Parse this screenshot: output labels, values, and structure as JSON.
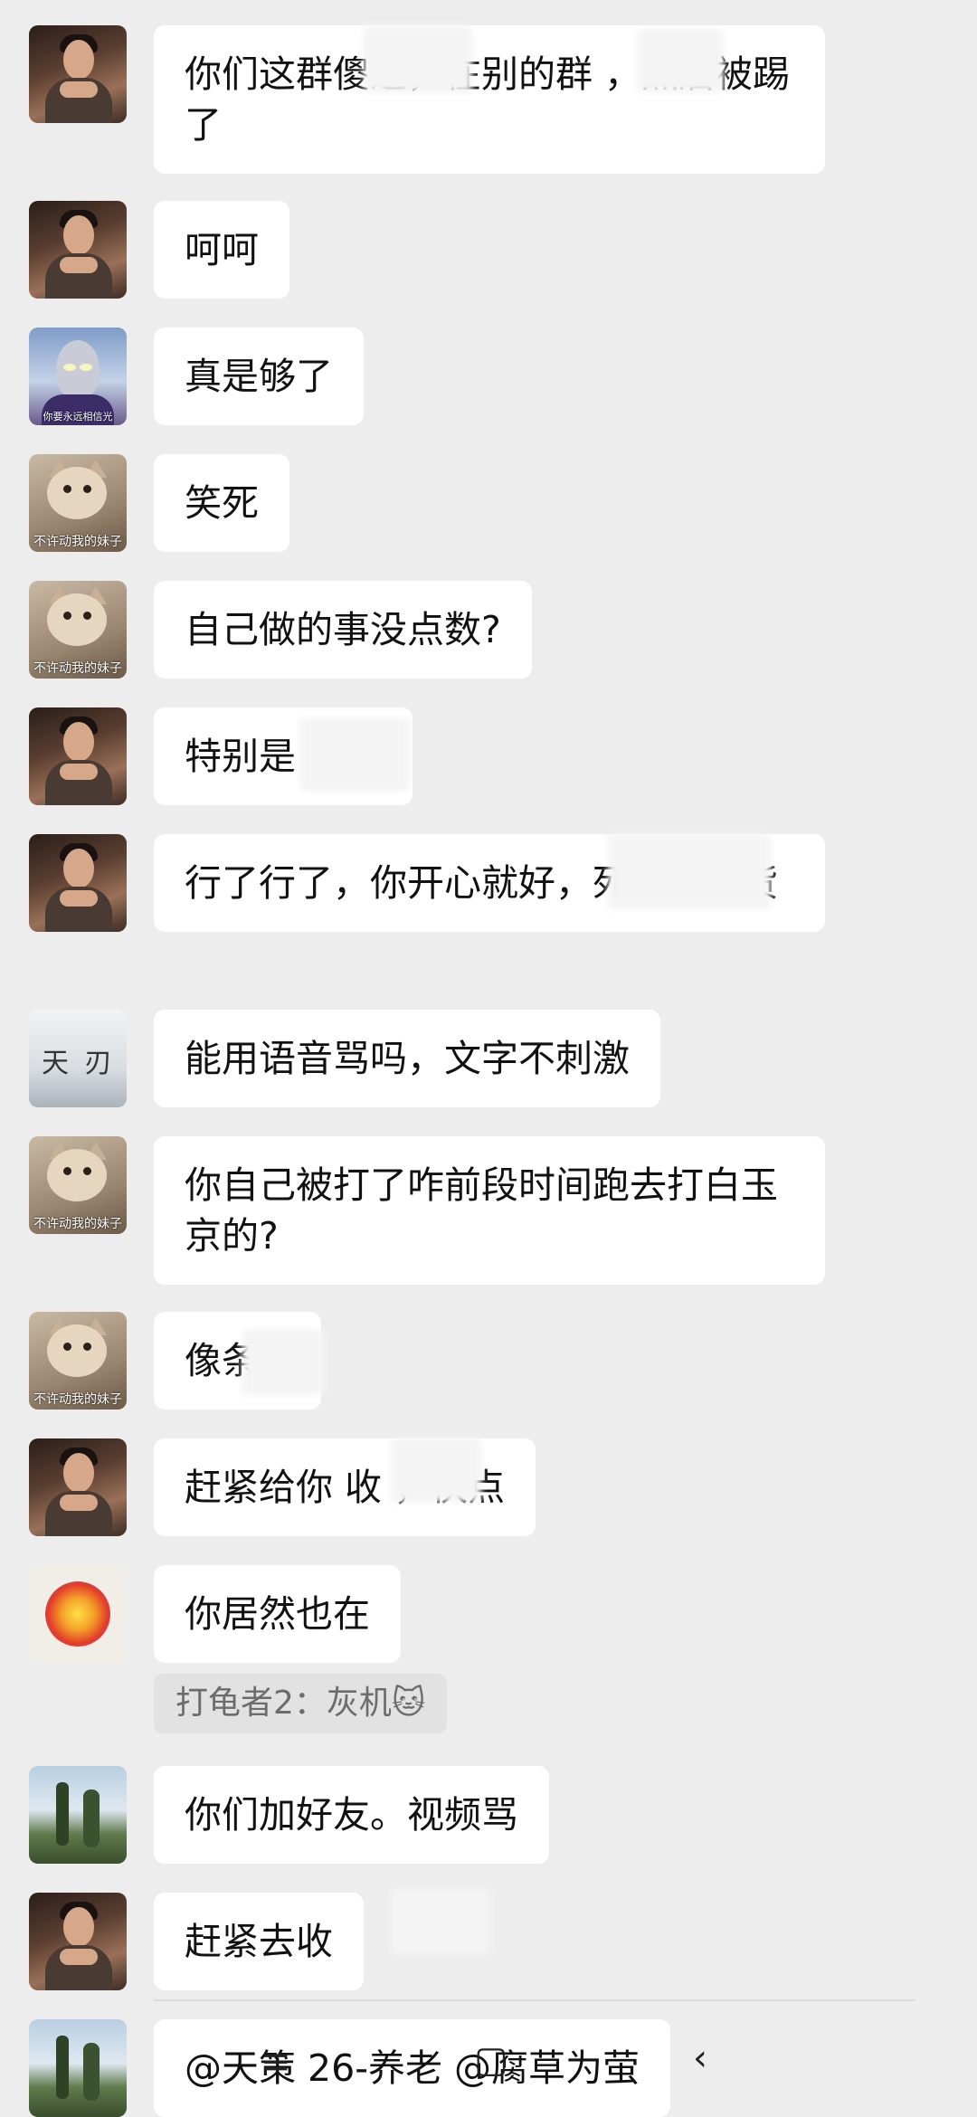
{
  "messages": [
    {
      "avatar": "man-portrait",
      "text": "你们这群傻逼，在别的群 ，然后被踢了"
    },
    {
      "avatar": "man-portrait",
      "text": "呵呵"
    },
    {
      "avatar": "ultraman",
      "caption": "你要永远相信光",
      "text": "真是够了"
    },
    {
      "avatar": "cat",
      "caption": "不许动我的妹子",
      "text": "笑死"
    },
    {
      "avatar": "cat",
      "caption": "不许动我的妹子",
      "text": "自己做的事没点数?"
    },
    {
      "avatar": "man-portrait",
      "text": "特别是   三代"
    },
    {
      "avatar": "man-portrait",
      "text": "行了行了，你开心就好，死全家的货"
    },
    {
      "avatar": "ink-painting",
      "caption": "天 刃",
      "text": "能用语音骂吗，文字不刺激"
    },
    {
      "avatar": "cat",
      "caption": "不许动我的妹子",
      "text": "你自己被打了咋前段时间跑去打白玉京的?"
    },
    {
      "avatar": "cat",
      "caption": "不许动我的妹子",
      "text": "像条  ?"
    },
    {
      "avatar": "man-portrait",
      "text": "赶紧给你   收  ，快点"
    },
    {
      "avatar": "explosion",
      "text": "你居然也在",
      "quote": "打龟者2：灰机"
    },
    {
      "avatar": "trees",
      "text": "你们加好友。视频骂"
    },
    {
      "avatar": "man-portrait",
      "text": "赶紧去收"
    },
    {
      "avatar": "trees",
      "text": "@天策 26-养老 @腐草为萤"
    }
  ],
  "quote_emoji": "🐱",
  "colors": {
    "background": "#ededed",
    "bubble": "#ffffff",
    "quote": "#e2e2e2"
  }
}
